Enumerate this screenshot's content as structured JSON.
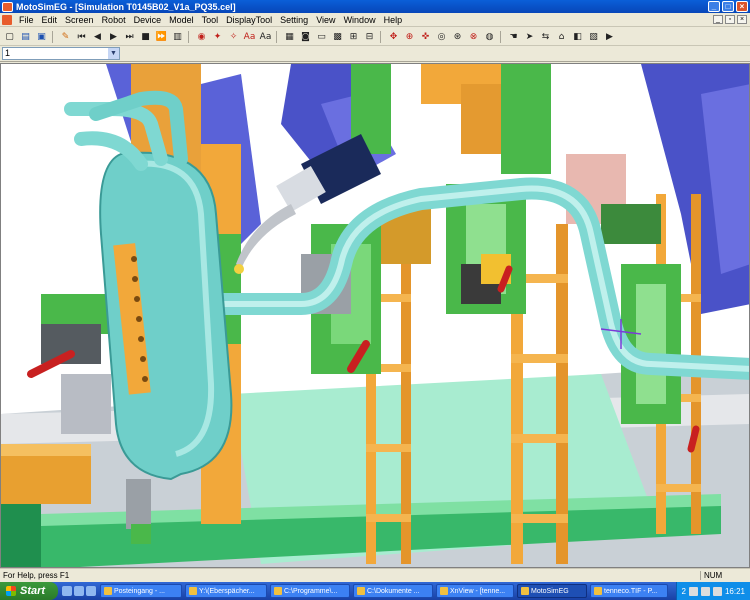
{
  "window": {
    "title": "MotoSimEG - [Simulation T0145B02_V1a_PQ35.cel]",
    "controls": [
      "_",
      "□",
      "×"
    ]
  },
  "menu": {
    "items": [
      "File",
      "Edit",
      "Screen",
      "Robot",
      "Device",
      "Model",
      "Tool",
      "DisplayTool",
      "Setting",
      "View",
      "Window",
      "Help"
    ],
    "mdi_controls": [
      "_",
      "▫",
      "×"
    ]
  },
  "toolbar": {
    "icons": [
      "new-icon",
      "open-icon",
      "save-icon",
      "pin-icon",
      "rewind-icon",
      "play-icon",
      "step-icon",
      "stop-icon",
      "goto-end-icon",
      "frame-icon",
      "record-icon",
      "robot-icon",
      "tool-icon",
      "camera-icon",
      "text-icon",
      "font-icon",
      "ruler-icon",
      "view-icon",
      "axis-icon",
      "rotate-icon",
      "zoom-icon",
      "pan-icon",
      "fit-icon",
      "layout-icon"
    ],
    "text_labels": {
      "aa1": "Aa",
      "aa2": "Aa"
    }
  },
  "selector": {
    "value": "1",
    "arrow": "▼"
  },
  "status": {
    "help": "For Help, press F1",
    "mode": "NUM"
  },
  "taskbar": {
    "start": "Start",
    "tasks": [
      {
        "label": "Posteingang - ...",
        "active": false
      },
      {
        "label": "Y:\\(Eberspächer...",
        "active": false
      },
      {
        "label": "C:\\Programme\\...",
        "active": false
      },
      {
        "label": "C:\\Dokumente ...",
        "active": false
      },
      {
        "label": "XnView - [tenne...",
        "active": false
      },
      {
        "label": "MotoSimEG",
        "active": true
      },
      {
        "label": "tenneco.TIF - P...",
        "active": false
      }
    ],
    "tray_num": "2",
    "clock": "16:21"
  },
  "colors": {
    "titlebar": "#0746b8",
    "pipe": "#7fd8d2",
    "fixture_orange": "#f2a83a",
    "fixture_green": "#4ab84a",
    "robot_blue": "#4a52c8",
    "floor_green": "#3fbf7a"
  }
}
